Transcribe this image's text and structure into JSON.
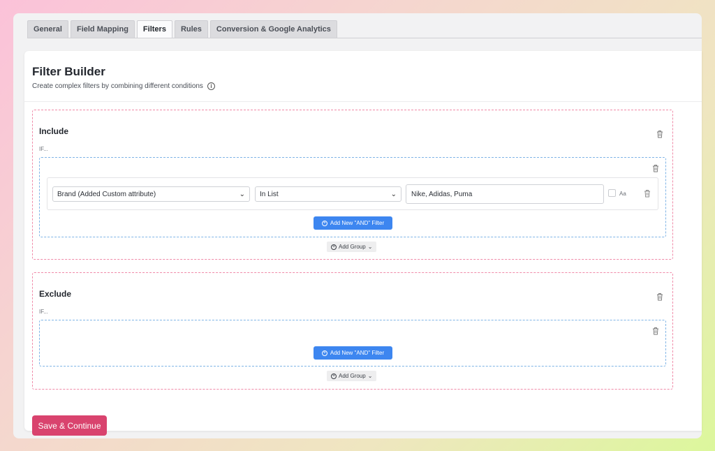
{
  "tabs": [
    {
      "label": "General"
    },
    {
      "label": "Field Mapping"
    },
    {
      "label": "Filters"
    },
    {
      "label": "Rules"
    },
    {
      "label": "Conversion & Google Analytics"
    }
  ],
  "active_tab": "Filters",
  "header": {
    "title": "Filter Builder",
    "subtitle": "Create complex filters by combining different conditions",
    "info_icon": "i"
  },
  "include": {
    "title": "Include",
    "if_label": "IF...",
    "filter": {
      "attribute": "Brand (Added Custom attribute)",
      "operator": "In List",
      "value": "Nike, Adidas, Puma",
      "case_label": "Aa"
    },
    "add_filter_label": "Add New \"AND\" Filter",
    "add_group_label": "Add Group"
  },
  "exclude": {
    "title": "Exclude",
    "if_label": "IF...",
    "add_filter_label": "Add New \"AND\" Filter",
    "add_group_label": "Add Group"
  },
  "save_label": "Save & Continue",
  "colors": {
    "accent_blue": "#3d86f0",
    "save_pink": "#d9436e",
    "section_border": "#f08aa8",
    "group_border": "#7fb4e6"
  }
}
